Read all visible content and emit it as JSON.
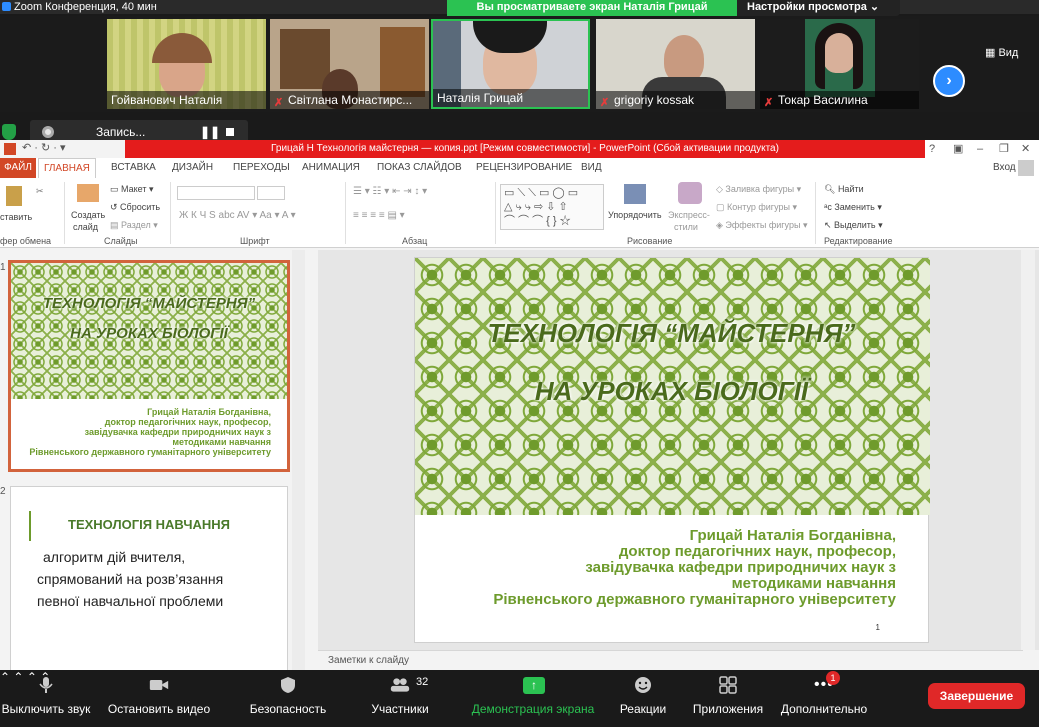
{
  "zoom": {
    "window_title": "Zoom Конференция, 40 мин",
    "share_banner": "Вы просматриваете экран Наталія Грицай",
    "view_settings": "Настройки просмотра ⌄",
    "view_label": "Вид",
    "participants": [
      {
        "name": "Гойванович Наталія",
        "muted": false
      },
      {
        "name": "Світлана Монастирс...",
        "muted": true
      },
      {
        "name": "Наталія Грицай",
        "muted": false,
        "active": true
      },
      {
        "name": "grigoriy kossak",
        "muted": true
      },
      {
        "name": "Токар Василина",
        "muted": true
      }
    ],
    "recording_label": "Запись...",
    "toolbar": {
      "mute": "Выключить звук",
      "video": "Остановить видео",
      "security": "Безопасность",
      "participants": "Участники",
      "participants_count": "32",
      "share": "Демонстрация экрана",
      "reactions": "Реакции",
      "apps": "Приложения",
      "more": "Дополнительно",
      "more_badge": "1",
      "end": "Завершение"
    }
  },
  "ppt": {
    "title": "Грицай Н Технологія майстерня — копия.ppt [Режим совместимости] - PowerPoint (Сбой активации продукта)",
    "login": "Вход",
    "tabs": [
      "ФАЙЛ",
      "ГЛАВНАЯ",
      "ВСТАВКА",
      "ДИЗАЙН",
      "ПЕРЕХОДЫ",
      "АНИМАЦИЯ",
      "ПОКАЗ СЛАЙДОВ",
      "РЕЦЕНЗИРОВАНИЕ",
      "ВИД"
    ],
    "ribbon": {
      "paste": "ставить",
      "clipboard": "фер обмена",
      "new_slide_1": "Создать",
      "new_slide_2": "слайд",
      "layout": "Макет",
      "reset": "Сбросить",
      "section": "Раздел",
      "slides": "Слайды",
      "font": "Шрифт",
      "paragraph": "Абзац",
      "arrange": "Упорядочить",
      "quick_styles_1": "Экспресс-",
      "quick_styles_2": "стили",
      "fill": "Заливка фигуры",
      "outline": "Контур фигуры",
      "effects": "Эффекты фигуры",
      "drawing": "Рисование",
      "find": "Найти",
      "replace": "Заменить",
      "select": "Выделить",
      "editing": "Редактирование"
    },
    "thumb1_num": "1",
    "thumb2_num": "2",
    "slide2": {
      "title": "ТЕХНОЛОГІЯ НАВЧАННЯ",
      "line1": "алгоритм дій вчителя,",
      "line2": "спрямований на розв’язання",
      "line3": "певної навчальної проблеми"
    },
    "slide1": {
      "title_line1": "ТЕХНОЛОГІЯ “МАЙСТЕРНЯ”",
      "title_line2": "НА УРОКАХ БІОЛОГІЇ",
      "author_name": "Грицай Наталія Богданівна,",
      "author_degree": "доктор педагогічних наук, професор,",
      "author_position": "завідувачка кафедри природничих наук з",
      "author_position2": "методиками навчання",
      "author_university": "Рівненського державного гуманітарного університету",
      "slide_number": "1"
    },
    "notes_placeholder": "Заметки к слайду"
  },
  "colors": {
    "zoom_green": "#2bc252",
    "ppt_red": "#e41c1c",
    "slide_green": "#6d9b2c",
    "end_red": "#e02828"
  }
}
